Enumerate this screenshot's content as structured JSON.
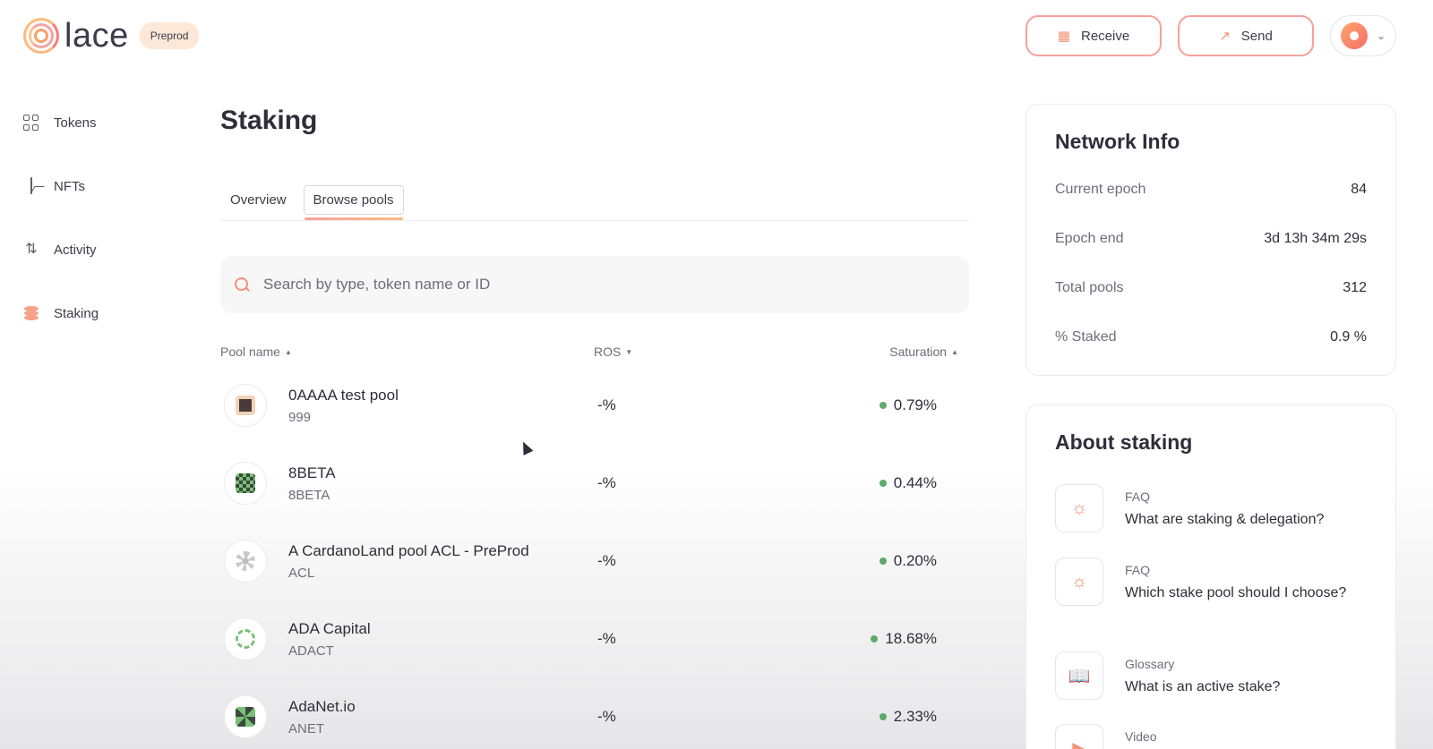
{
  "header": {
    "brand": "lace",
    "network_badge": "Preprod",
    "receive_label": "Receive",
    "send_label": "Send"
  },
  "sidebar": {
    "items": [
      {
        "label": "Tokens",
        "icon": "tokens-grid-icon"
      },
      {
        "label": "NFTs",
        "icon": "nft-image-icon"
      },
      {
        "label": "Activity",
        "icon": "activity-arrows-icon"
      },
      {
        "label": "Staking",
        "icon": "staking-stack-icon",
        "active": true
      }
    ]
  },
  "main": {
    "title": "Staking",
    "tabs": [
      {
        "label": "Overview",
        "active": false
      },
      {
        "label": "Browse pools",
        "active": true
      }
    ],
    "search": {
      "placeholder": "Search by type, token name or ID"
    },
    "columns": {
      "pool_name": "Pool name",
      "ros": "ROS",
      "saturation": "Saturation"
    },
    "pools": [
      {
        "name": "0AAAA test pool",
        "ticker": "999",
        "ros": "-%",
        "saturation": "0.79%"
      },
      {
        "name": "8BETA",
        "ticker": "8BETA",
        "ros": "-%",
        "saturation": "0.44%"
      },
      {
        "name": "A CardanoLand pool ACL - PreProd",
        "ticker": "ACL",
        "ros": "-%",
        "saturation": "0.20%"
      },
      {
        "name": "ADA Capital",
        "ticker": "ADACT",
        "ros": "-%",
        "saturation": "18.68%"
      },
      {
        "name": "AdaNet.io",
        "ticker": "ANET",
        "ros": "-%",
        "saturation": "2.33%"
      }
    ]
  },
  "network_info": {
    "title": "Network Info",
    "rows": [
      {
        "label": "Current epoch",
        "value": "84"
      },
      {
        "label": "Epoch end",
        "value": "3d 13h 34m 29s"
      },
      {
        "label": "Total pools",
        "value": "312"
      },
      {
        "label": "% Staked",
        "value": "0.9 %"
      }
    ]
  },
  "about_staking": {
    "title": "About staking",
    "items": [
      {
        "kind": "FAQ",
        "question": "What are staking & delegation?",
        "icon": "lightbulb-icon"
      },
      {
        "kind": "FAQ",
        "question": "Which stake pool should I choose?",
        "icon": "lightbulb-icon"
      },
      {
        "kind": "Glossary",
        "question": "What is an active stake?",
        "icon": "book-icon"
      },
      {
        "kind": "Video",
        "question": "",
        "icon": "video-icon"
      }
    ]
  },
  "colors": {
    "accent": "#f29174",
    "accent_pink": "#f7a19b",
    "saturation_ok": "#5fa86b"
  }
}
